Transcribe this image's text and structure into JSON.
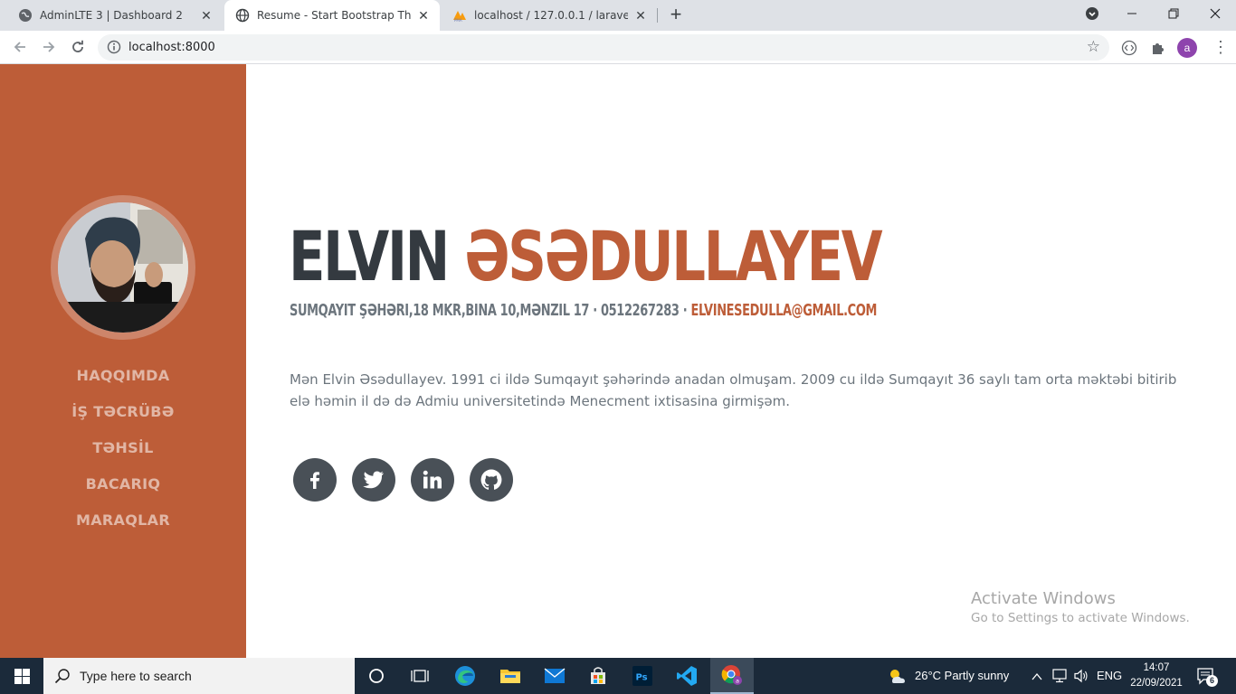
{
  "browser": {
    "tabs": [
      {
        "title": "AdminLTE 3 | Dashboard 2",
        "active": false
      },
      {
        "title": "Resume - Start Bootstrap Theme",
        "active": true
      },
      {
        "title": "localhost / 127.0.0.1 / laravelcv2",
        "active": false
      }
    ],
    "new_tab": "+",
    "url": "localhost:8000",
    "profile_initial": "a"
  },
  "sidebar": {
    "nav": [
      "HAQQIMDA",
      "İŞ TƏCRÜBƏ",
      "TƏHSİL",
      "BACARIQ",
      "MARAQLAR"
    ],
    "color": "#bd5d38"
  },
  "hero": {
    "first_name": "ELVIN",
    "last_name": "ƏSƏDULLAYEV",
    "address": "SUMQAYIT ŞƏHƏRI,18 MKR,BINA 10,MƏNZIL 17",
    "separator": "·",
    "phone": "0512267283",
    "email": "ELVINESEDULLA@GMAIL.COM",
    "bio": "Mən Elvin Əsədullayev. 1991 ci ildə Sumqayıt şəhərində anadan olmuşam. 2009 cu ildə Sumqayıt 36 saylı tam orta məktəbi bitirib elə həmin il də də Admiu universitetində Menecment ixtisasina girmişəm.",
    "social": [
      "facebook-icon",
      "twitter-icon",
      "linkedin-icon",
      "github-icon"
    ]
  },
  "watermark": {
    "title": "Activate Windows",
    "subtitle": "Go to Settings to activate Windows."
  },
  "taskbar": {
    "search_placeholder": "Type here to search",
    "weather": "26°C  Partly sunny",
    "lang": "ENG",
    "time": "14:07",
    "date": "22/09/2021",
    "notifications": "6"
  }
}
